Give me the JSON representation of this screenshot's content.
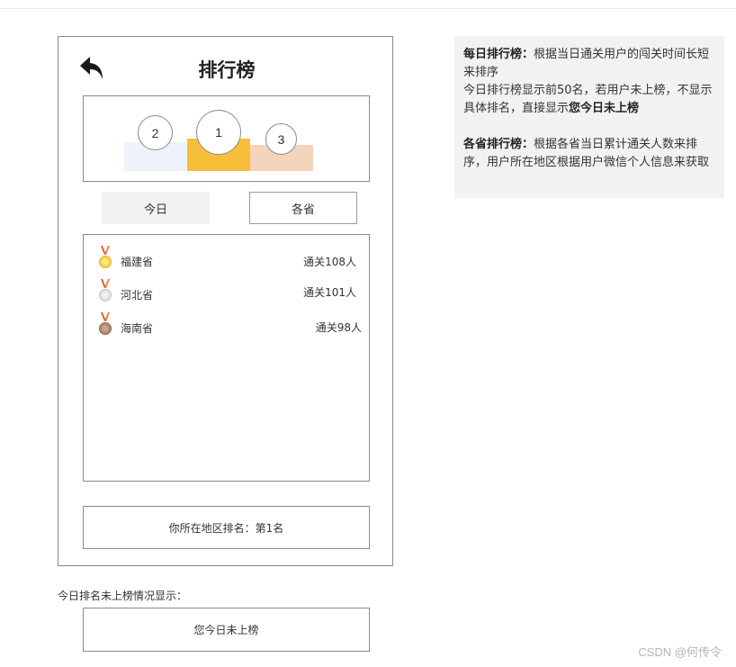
{
  "header": {
    "title": "排行榜"
  },
  "podium": {
    "first": "1",
    "second": "2",
    "third": "3"
  },
  "tabs": {
    "today": "今日",
    "province": "各省"
  },
  "ranking": [
    {
      "name": "福建省",
      "count": "通关108人",
      "medal": "gold-medal-icon"
    },
    {
      "name": "河北省",
      "count": "通关101人",
      "medal": "silver-medal-icon"
    },
    {
      "name": "海南省",
      "count": "通关98人",
      "medal": "bronze-medal-icon"
    }
  ],
  "region_rank": "你所在地区排名：第1名",
  "not_listed_label": "今日排名未上榜情况显示：",
  "not_listed_text": "您今日未上榜",
  "note": {
    "daily_title": "每日排行榜：",
    "daily_desc": "根据当日通关用户的闯关时间长短来排序",
    "daily_line2": "今日排行榜显示前50名，若用户未上榜，不显示具体排名，直接显示",
    "daily_bold": "您今日未上榜",
    "prov_title": "各省排行榜：",
    "prov_desc": "根据各省当日累计通关人数来排序，用户所在地区根据用户微信个人信息来获取"
  },
  "watermark": "CSDN @何传令",
  "colors": {
    "gold": "#f7be3b",
    "silver_bg": "#eef3fb",
    "bronze_bg": "#f3d5bc",
    "note_bg": "#f2f2f2"
  }
}
